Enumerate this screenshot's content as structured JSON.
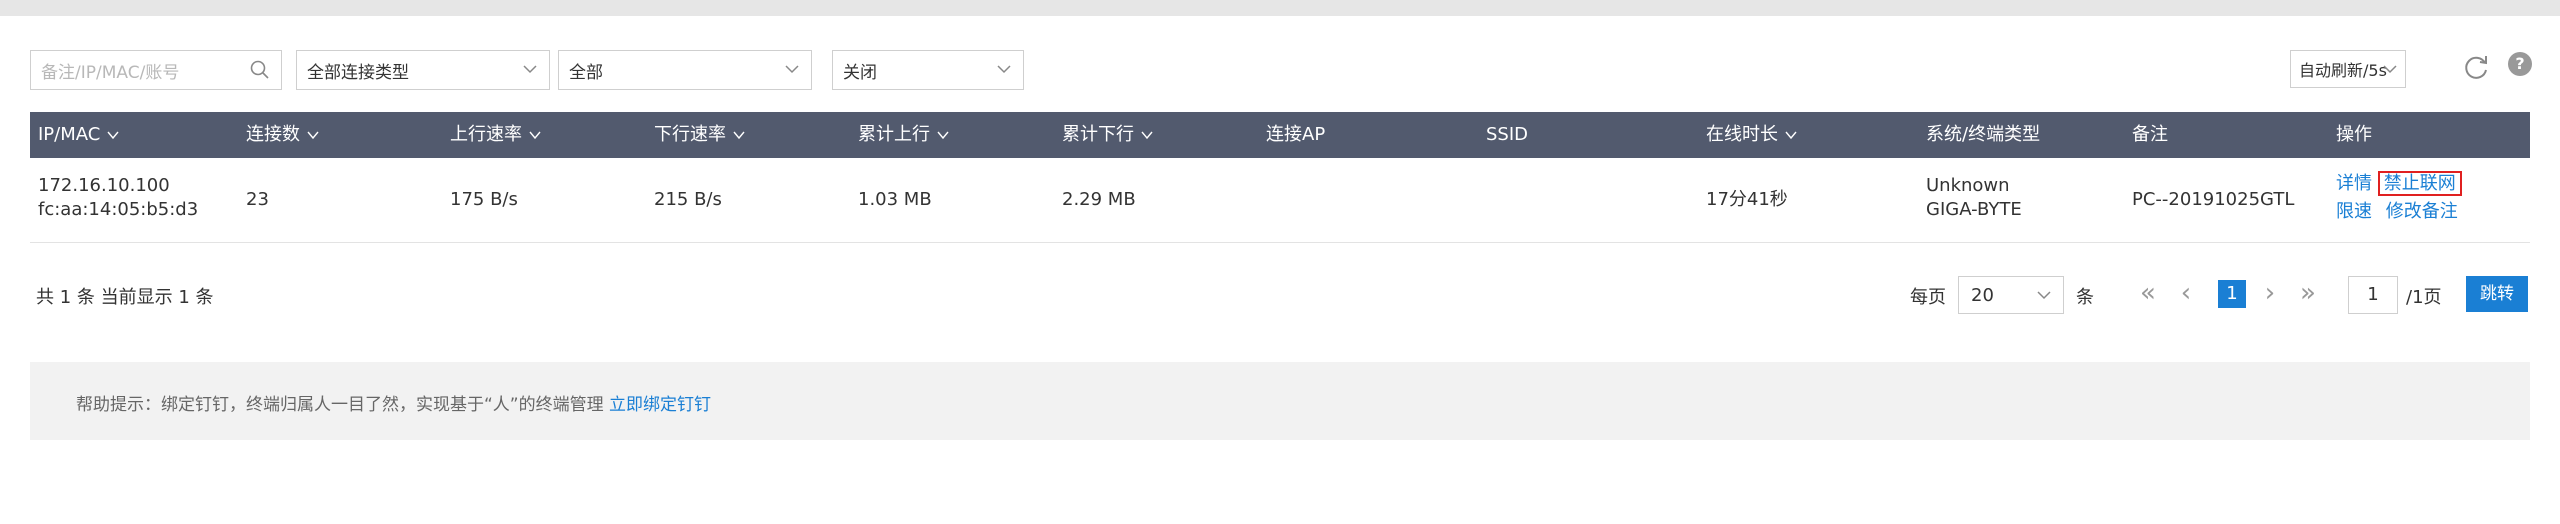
{
  "filters": {
    "search_placeholder": "备注/IP/MAC/账号",
    "connection_type": "全部连接类型",
    "all": "全部",
    "status": "关闭",
    "auto_refresh": "自动刷新/5s"
  },
  "table": {
    "headers": [
      "IP/MAC",
      "连接数",
      "上行速率",
      "下行速率",
      "累计上行",
      "累计下行",
      "连接AP",
      "SSID",
      "在线时长",
      "系统/终端类型",
      "备注",
      "操作"
    ],
    "row": {
      "ip": "172.16.10.100",
      "mac": "fc:aa:14:05:b5:d3",
      "connections": "23",
      "up_rate": "175 B/s",
      "down_rate": "215 B/s",
      "total_up": "1.03 MB",
      "total_down": "2.29 MB",
      "ap": "",
      "ssid": "",
      "online": "17分41秒",
      "os": "Unknown",
      "device": "GIGA-BYTE",
      "remark": "PC--20191025GTL",
      "actions": {
        "detail": "详情",
        "block": "禁止联网",
        "limit": "限速",
        "edit_remark": "修改备注"
      }
    }
  },
  "pagination": {
    "summary": "共 1 条 当前显示 1 条",
    "per_page_label": "每页",
    "per_page": "20",
    "unit": "条",
    "current": "1",
    "page_input": "1",
    "total_pages": "/1页",
    "jump": "跳转"
  },
  "tip": {
    "text": "帮助提示：绑定钉钉，终端归属人一目了然，实现基于“人”的终端管理",
    "link": "立即绑定钉钉"
  },
  "colors": {
    "header_bg": "#525a6e",
    "accent": "#1a7fd4",
    "highlight": "#e02020"
  }
}
